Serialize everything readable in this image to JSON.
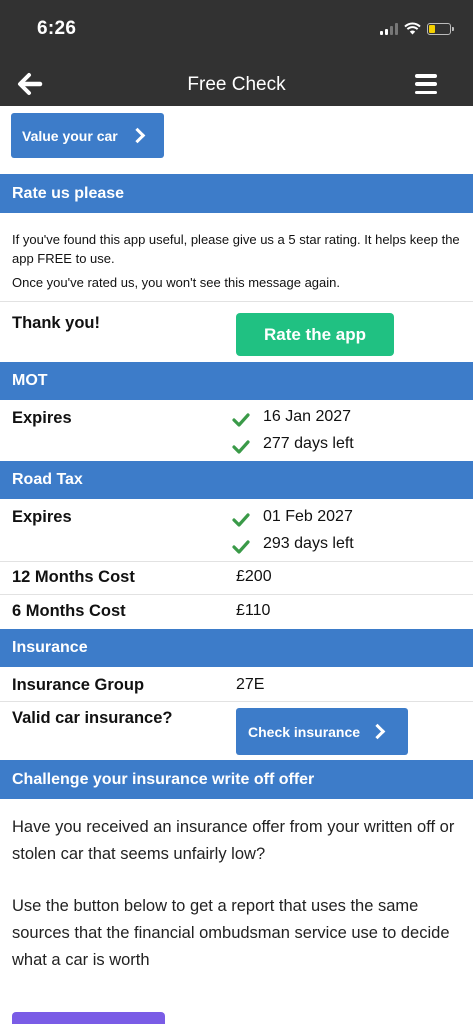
{
  "status_bar": {
    "time": "6:26"
  },
  "header": {
    "title": "Free Check"
  },
  "value_button": {
    "label": "Value your car"
  },
  "rate": {
    "heading": "Rate us please",
    "line1": "If you've found this app useful, please give us a 5 star rating. It helps keep the app FREE to use.",
    "line2": "Once you've rated us, you won't see this message again.",
    "thanks": "Thank you!",
    "button": "Rate the app"
  },
  "mot": {
    "heading": "MOT",
    "expires_label": "Expires",
    "date": "16 Jan 2027",
    "days": "277 days left"
  },
  "road_tax": {
    "heading": "Road Tax",
    "expires_label": "Expires",
    "date": "01 Feb 2027",
    "days": "293 days left",
    "cost12_label": "12 Months Cost",
    "cost12": "£200",
    "cost6_label": "6 Months Cost",
    "cost6": "£110"
  },
  "insurance": {
    "heading": "Insurance",
    "group_label": "Insurance Group",
    "group": "27E",
    "valid_label": "Valid car insurance?",
    "button": "Check insurance"
  },
  "challenge": {
    "heading": "Challenge your insurance write off offer",
    "para1": "Have you received an insurance offer from your written off or stolen car that seems unfairly low?",
    "para2": "Use the button below to get a report that uses the same sources that the financial ombudsman service use to decide what a car is worth"
  },
  "colors": {
    "accent": "#3d7cc9",
    "green": "#20c182",
    "dark": "#323232",
    "purple": "#7a5ce6"
  },
  "icons": [
    "back-arrow-icon",
    "menu-icon",
    "chevron-right-icon",
    "check-icon",
    "signal-icon",
    "wifi-icon",
    "battery-icon"
  ]
}
